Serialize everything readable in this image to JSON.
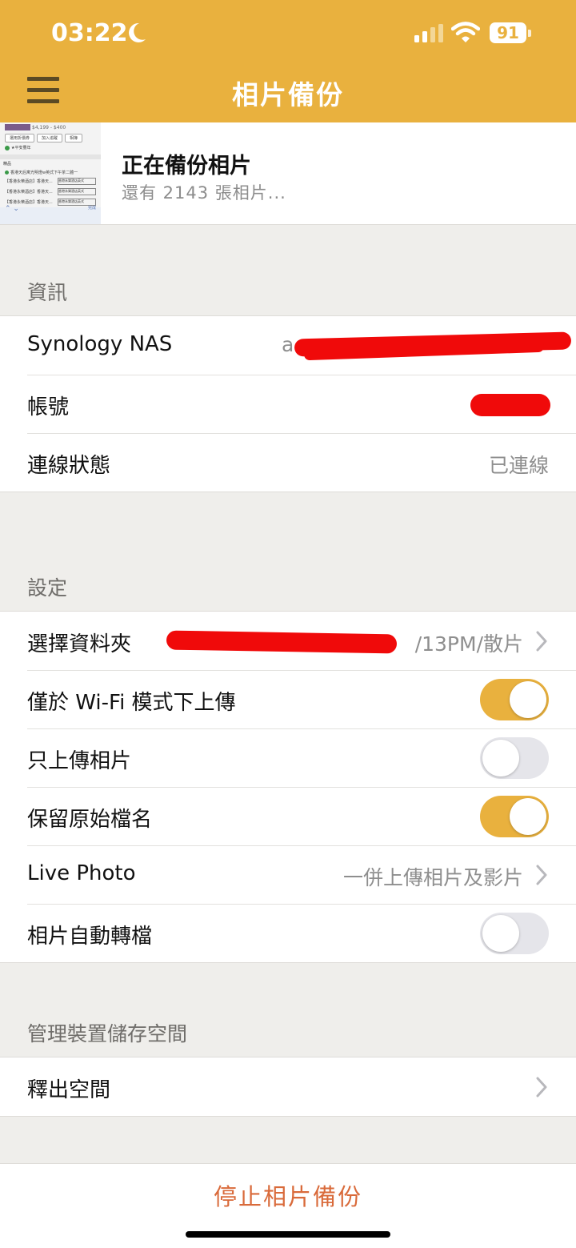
{
  "status_bar": {
    "time": "03:22",
    "battery": "91"
  },
  "nav": {
    "title": "相片備份",
    "menu_icon": "hamburger-icon"
  },
  "backup": {
    "title": "正在備份相片",
    "subtitle": "還有 2143 張相片...",
    "thumb": {
      "price": "$4,199 - $400",
      "buttons": [
        "選用折價券",
        "加入追蹤",
        "相簿"
      ],
      "check_text": "★平安豐年",
      "section": "精品",
      "list_title": "香港天后寓光明燈w英式下午茶二體一",
      "items": [
        "【香港永樂酒店】香港天...",
        "【香港永樂酒店】香港天...",
        "【香港永樂酒店】香港天..."
      ],
      "item_badge": "香港永樂酒店英式",
      "done": "完成"
    }
  },
  "info": {
    "header": "資訊",
    "rows": [
      {
        "label": "Synology NAS",
        "value": "a"
      },
      {
        "label": "帳號",
        "value": ""
      },
      {
        "label": "連線狀態",
        "value": "已連線"
      }
    ]
  },
  "settings": {
    "header": "設定",
    "folder": {
      "label": "選擇資料夾",
      "value": "/13PM/散片"
    },
    "wifi_only": {
      "label": "僅於 Wi-Fi 模式下上傳",
      "on": true
    },
    "photos_only": {
      "label": "只上傳相片",
      "on": false
    },
    "keep_names": {
      "label": "保留原始檔名",
      "on": true
    },
    "live_photo": {
      "label": "Live Photo",
      "value": "一併上傳相片及影片"
    },
    "auto_convert": {
      "label": "相片自動轉檔",
      "on": false
    }
  },
  "storage": {
    "header": "管理裝置儲存空間",
    "free_space": {
      "label": "釋出空間"
    }
  },
  "footer": {
    "stop_label": "停止相片備份"
  },
  "colors": {
    "accent": "#e9b13e",
    "stop": "#d96a3a",
    "redaction": "#f00a0a"
  }
}
